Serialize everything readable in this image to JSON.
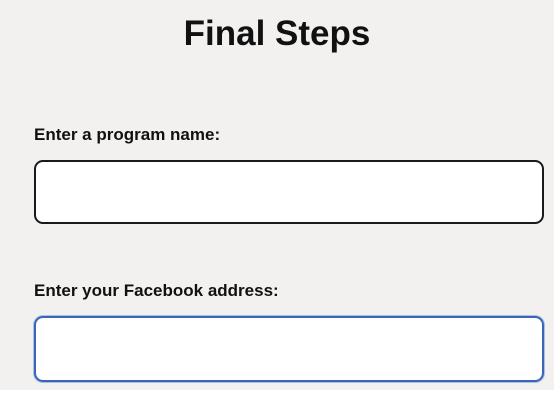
{
  "form": {
    "title": "Final Steps",
    "program_name": {
      "label": "Enter a program name:",
      "value": "",
      "placeholder": ""
    },
    "facebook_address": {
      "label": "Enter your Facebook address:",
      "value": "",
      "placeholder": ""
    }
  },
  "colors": {
    "panel_background": "#f2f1f0",
    "focused_border": "#3b66b5",
    "default_border": "#1a1a1a"
  }
}
